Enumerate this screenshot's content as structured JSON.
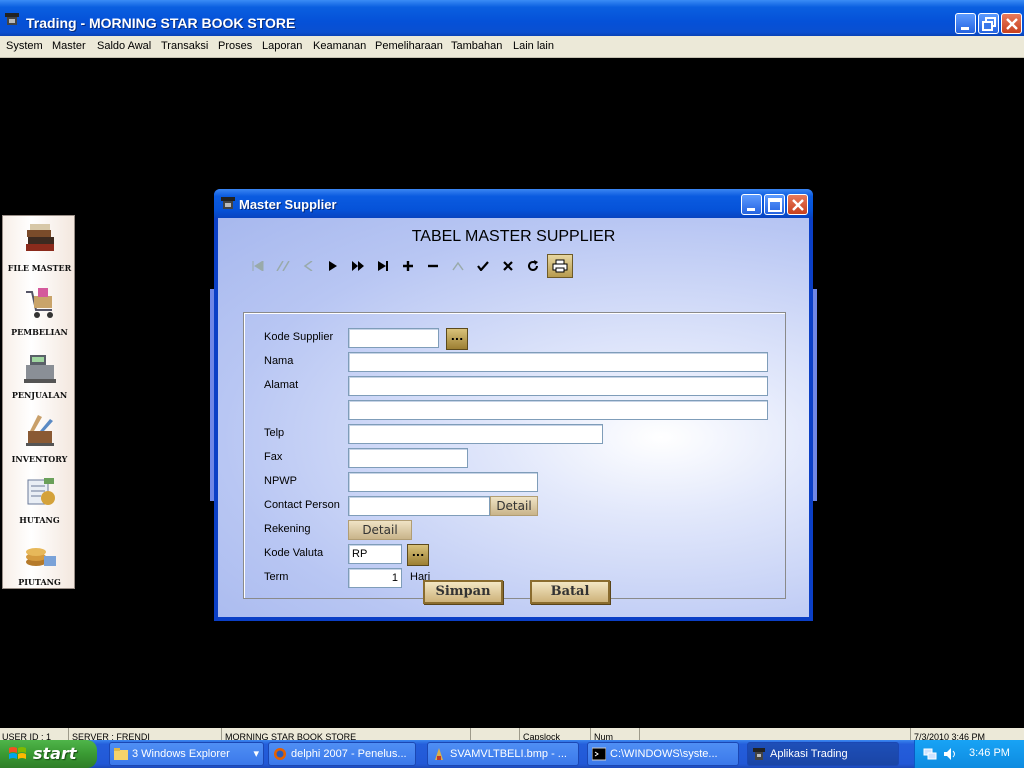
{
  "window": {
    "title": "Trading - MORNING STAR BOOK STORE"
  },
  "menu": [
    "System",
    "Master",
    "Saldo Awal",
    "Transaksi",
    "Proses",
    "Laporan",
    "Keamanan",
    "Pemeliharaan",
    "Tambahan",
    "Lain lain"
  ],
  "sidebar": {
    "items": [
      {
        "label": "FILE MASTER",
        "icon": "books-icon"
      },
      {
        "label": "PEMBELIAN",
        "icon": "shopping-cart-icon"
      },
      {
        "label": "PENJUALAN",
        "icon": "cash-register-icon"
      },
      {
        "label": "INVENTORY",
        "icon": "inventory-icon"
      },
      {
        "label": "HUTANG",
        "icon": "payable-icon"
      },
      {
        "label": "PIUTANG",
        "icon": "coins-icon"
      }
    ]
  },
  "dialog": {
    "title": "Master Supplier",
    "heading": "TABEL MASTER SUPPLIER",
    "fields": {
      "kode_supplier": {
        "label": "Kode Supplier",
        "value": ""
      },
      "nama": {
        "label": "Nama",
        "value": ""
      },
      "alamat": {
        "label": "Alamat",
        "value1": "",
        "value2": ""
      },
      "telp": {
        "label": "Telp",
        "value": ""
      },
      "fax": {
        "label": "Fax",
        "value": ""
      },
      "npwp": {
        "label": "NPWP",
        "value": ""
      },
      "contact_person": {
        "label": "Contact Person",
        "value": "",
        "button": "Detail"
      },
      "rekening": {
        "label": "Rekening",
        "button": "Detail"
      },
      "kode_valuta": {
        "label": "Kode Valuta",
        "value": "RP"
      },
      "term": {
        "label": "Term",
        "value": "1",
        "suffix": "Hari"
      }
    },
    "lookup_button": "...",
    "buttons": {
      "save": "Simpan",
      "cancel": "Batal"
    }
  },
  "statusbar": [
    "USER ID : 1",
    "SERVER : FRENDI",
    "MORNING STAR BOOK STORE",
    "",
    "Capslock",
    "Num",
    "",
    "7/3/2010 3:46 PM"
  ],
  "taskbar": {
    "start": "start",
    "tasks": [
      "3 Windows Explorer",
      "delphi 2007 - Penelus...",
      "SVAMVLTBELI.bmp - ...",
      "C:\\WINDOWS\\syste...",
      "Aplikasi Trading"
    ],
    "clock": "3:46 PM"
  },
  "colors": {
    "titlebar": "#0551d8",
    "dialog_bg": "#b8c6f3",
    "menu_bg": "#ece9d8",
    "start_green": "#3a9a33"
  }
}
